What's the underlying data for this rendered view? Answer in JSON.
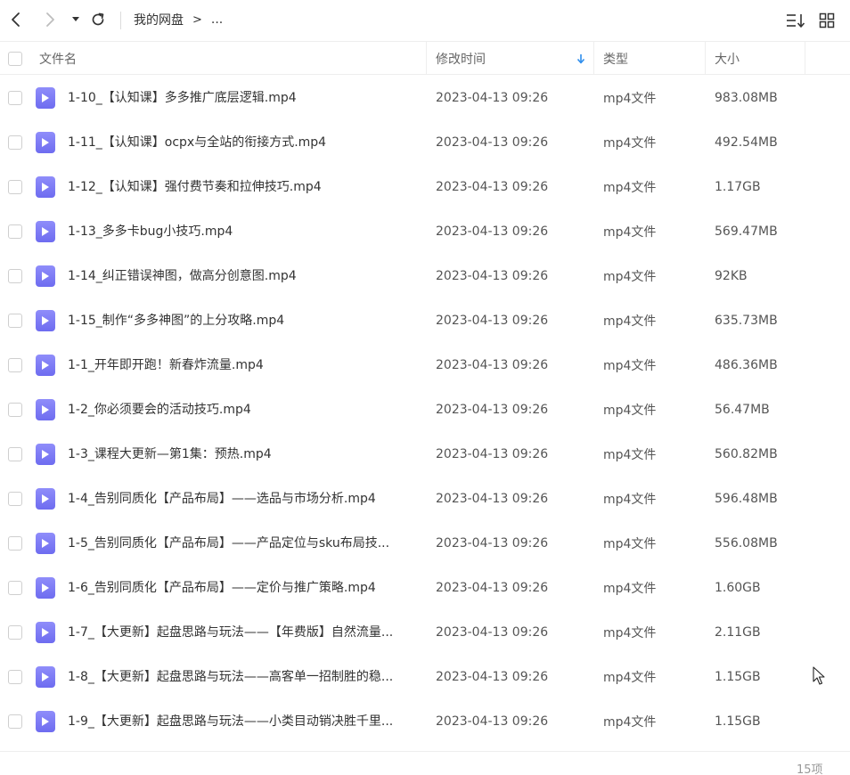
{
  "toolbar": {
    "back_icon": "chevron-left-icon",
    "forward_icon": "chevron-right-icon",
    "history_icon": "caret-down-icon",
    "refresh_icon": "refresh-icon",
    "breadcrumb": [
      "我的网盘",
      ">",
      "..."
    ],
    "sort_icon": "sort-list-icon",
    "view_icon": "grid-view-icon"
  },
  "table": {
    "columns": {
      "name": "文件名",
      "time": "修改时间",
      "type": "类型",
      "size": "大小"
    },
    "sorted_by": "修改时间",
    "rows": [
      {
        "name": "1-10_【认知课】多多推广底层逻辑.mp4",
        "time": "2023-04-13 09:26",
        "type": "mp4文件",
        "size": "983.08MB"
      },
      {
        "name": "1-11_【认知课】ocpx与全站的衔接方式.mp4",
        "time": "2023-04-13 09:26",
        "type": "mp4文件",
        "size": "492.54MB"
      },
      {
        "name": "1-12_【认知课】强付费节奏和拉伸技巧.mp4",
        "time": "2023-04-13 09:26",
        "type": "mp4文件",
        "size": "1.17GB"
      },
      {
        "name": "1-13_多多卡bug小技巧.mp4",
        "time": "2023-04-13 09:26",
        "type": "mp4文件",
        "size": "569.47MB"
      },
      {
        "name": "1-14_纠正错误神图，做高分创意图.mp4",
        "time": "2023-04-13 09:26",
        "type": "mp4文件",
        "size": "92KB"
      },
      {
        "name": "1-15_制作“多多神图”的上分攻略.mp4",
        "time": "2023-04-13 09:26",
        "type": "mp4文件",
        "size": "635.73MB"
      },
      {
        "name": "1-1_开年即开跑！新春炸流量.mp4",
        "time": "2023-04-13 09:26",
        "type": "mp4文件",
        "size": "486.36MB"
      },
      {
        "name": "1-2_你必须要会的活动技巧.mp4",
        "time": "2023-04-13 09:26",
        "type": "mp4文件",
        "size": "56.47MB"
      },
      {
        "name": "1-3_课程大更新—第1集：预热.mp4",
        "time": "2023-04-13 09:26",
        "type": "mp4文件",
        "size": "560.82MB"
      },
      {
        "name": "1-4_告别同质化【产品布局】——选品与市场分析.mp4",
        "time": "2023-04-13 09:26",
        "type": "mp4文件",
        "size": "596.48MB"
      },
      {
        "name": "1-5_告别同质化【产品布局】——产品定位与sku布局技...",
        "time": "2023-04-13 09:26",
        "type": "mp4文件",
        "size": "556.08MB"
      },
      {
        "name": "1-6_告别同质化【产品布局】——定价与推广策略.mp4",
        "time": "2023-04-13 09:26",
        "type": "mp4文件",
        "size": "1.60GB"
      },
      {
        "name": "1-7_【大更新】起盘思路与玩法——【年费版】自然流量...",
        "time": "2023-04-13 09:26",
        "type": "mp4文件",
        "size": "2.11GB"
      },
      {
        "name": "1-8_【大更新】起盘思路与玩法——高客单一招制胜的稳...",
        "time": "2023-04-13 09:26",
        "type": "mp4文件",
        "size": "1.15GB"
      },
      {
        "name": "1-9_【大更新】起盘思路与玩法——小类目动销决胜千里...",
        "time": "2023-04-13 09:26",
        "type": "mp4文件",
        "size": "1.15GB"
      }
    ]
  },
  "footer": {
    "count": "15项"
  },
  "colors": {
    "accent": "#2e8ded",
    "file_icon": "#7b79f5",
    "border": "#eeeeee",
    "muted_text": "#999999"
  }
}
